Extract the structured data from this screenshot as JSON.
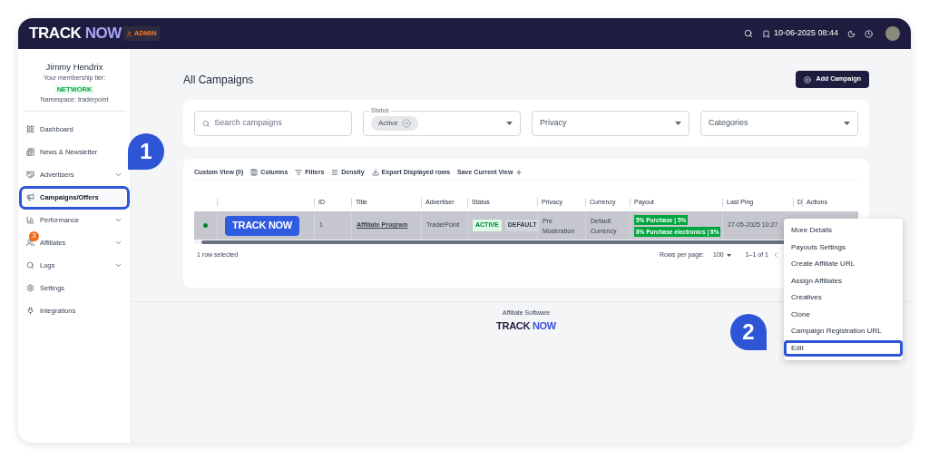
{
  "header": {
    "logo": [
      "TRACK",
      "NOW"
    ],
    "role_badge": "ADMIN",
    "datetime": "10-06-2025 08:44"
  },
  "user": {
    "name": "Jimmy Hendrix",
    "tier_label": "Your membership tier:",
    "tier": "NETWORK",
    "namespace": "Namespace: traderpoint"
  },
  "sidebar": {
    "items": [
      {
        "label": "Dashboard",
        "selected": false,
        "expandable": false
      },
      {
        "label": "News & Newsletter",
        "selected": false,
        "expandable": false
      },
      {
        "label": "Advertisers",
        "selected": false,
        "expandable": true
      },
      {
        "label": "Campaigns/Offers",
        "selected": true,
        "expandable": false
      },
      {
        "label": "Performance",
        "selected": false,
        "expandable": true
      },
      {
        "label": "Affiliates",
        "selected": false,
        "expandable": true,
        "badge": "3"
      },
      {
        "label": "Logs",
        "selected": false,
        "expandable": true
      },
      {
        "label": "Settings",
        "selected": false,
        "expandable": false
      },
      {
        "label": "Integrations",
        "selected": false,
        "expandable": false
      }
    ]
  },
  "page": {
    "title": "All Campaigns",
    "add_button": "Add Campaign"
  },
  "filters": {
    "search": {
      "placeholder": "Search campaigns"
    },
    "status": {
      "label": "Status",
      "chip": "Active"
    },
    "privacy": {
      "placeholder": "Privacy"
    },
    "categories": {
      "placeholder": "Categories"
    }
  },
  "toolbar": [
    "Custom View (0)",
    "Columns",
    "Filters",
    "Density",
    "Export Displayed rows",
    "Save Current View"
  ],
  "table": {
    "columns": [
      "ID",
      "Title",
      "Advertiser",
      "Status",
      "Privacy",
      "Currency",
      "Payout",
      "Last Ping",
      "D",
      "Actions"
    ],
    "rows": [
      {
        "selected": true,
        "online": true,
        "image_logo": [
          "TRACK",
          "NOW"
        ],
        "id": "1",
        "title": "Affiliate Program",
        "advertiser": "TraderPoint",
        "status": "ACTIVE",
        "default_tag": "DEFAULT",
        "privacy": "Pre Moderation",
        "currency": "Default Currency",
        "payouts": [
          "5% Purchase | 5%",
          "8% Purchase electronics | 8%"
        ],
        "last_ping": "27-05-2025 10:27"
      }
    ],
    "selection_text": "1 row selected",
    "rows_per_page_label": "Rows per page:",
    "rows_per_page": "100",
    "range": "1–1 of 1"
  },
  "footer": {
    "caption": "Affiliate Software",
    "logo": [
      "TRACK",
      "NOW"
    ]
  },
  "actions_menu": [
    {
      "label": "More Details",
      "selected": false
    },
    {
      "label": "Payouts Settings",
      "selected": false
    },
    {
      "label": "Create Affiliate URL",
      "selected": false
    },
    {
      "label": "Assign Affiliates",
      "selected": false
    },
    {
      "label": "Creatives",
      "selected": false
    },
    {
      "label": "Clone",
      "selected": false
    },
    {
      "label": "Campaign Registration URL",
      "selected": false
    },
    {
      "label": "Edit",
      "selected": true
    }
  ],
  "callouts": [
    "1",
    "2"
  ]
}
